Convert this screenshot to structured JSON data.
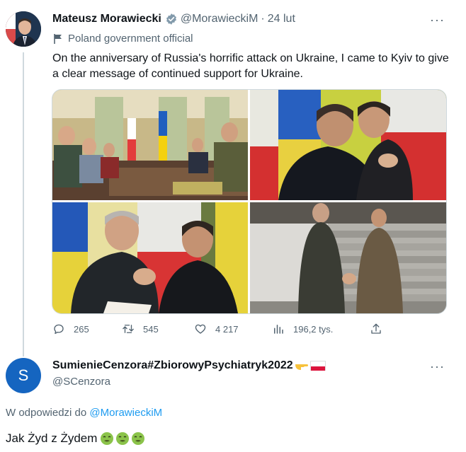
{
  "tweet": {
    "author_name": "Mateusz Morawiecki",
    "handle": "@MorawieckiM",
    "separator": "·",
    "date": "24 lut",
    "label": "Poland government official",
    "text": "On the anniversary of Russia's horrific attack on Ukraine, I came to Kyiv to give a clear message of continued support for Ukraine.",
    "stats": {
      "replies": "265",
      "retweets": "545",
      "likes": "4 217",
      "views": "196,2 tys."
    }
  },
  "reply": {
    "author_name": "SumienieCenzora#ZbiorowyPsychiatryk2022",
    "handle": "@SCenzora",
    "avatar_letter": "S",
    "reply_to_prefix": "W odpowiedzi do",
    "reply_to_handle": "@MorawieckiM",
    "text": "Jak Żyd z Żydem"
  },
  "icons": {
    "more": "more-dots-icon",
    "verified": "verified-badge-icon",
    "label": "government-flag-icon",
    "reply": "reply-icon",
    "retweet": "retweet-icon",
    "like": "heart-icon",
    "views": "views-chart-icon",
    "share": "share-icon"
  },
  "colors": {
    "accent": "#1d9bf0",
    "verified_badge": "#829aab",
    "secondary_text": "#536471",
    "reply_avatar": "#1565c0"
  }
}
